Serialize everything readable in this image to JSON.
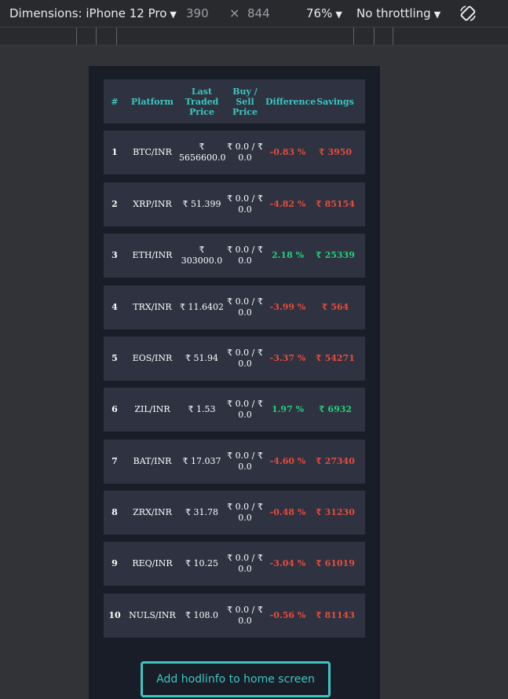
{
  "devtools": {
    "device_label": "Dimensions: iPhone 12 Pro",
    "width_value": "390",
    "times_symbol": "×",
    "height_value": "844",
    "zoom": "76%",
    "throttle": "No throttling",
    "caret": "▼"
  },
  "table": {
    "headers": [
      "#",
      "Platform",
      "Last Traded Price",
      "Buy / Sell Price",
      "Difference",
      "Savings"
    ],
    "rows": [
      {
        "num": "1",
        "platform": "BTC/INR",
        "ltp": "₹ 5656600.0",
        "bsp": "₹ 0.0 / ₹ 0.0",
        "diff": "-0.83 %",
        "savings": "₹ 3950",
        "trend": "neg"
      },
      {
        "num": "2",
        "platform": "XRP/INR",
        "ltp": "₹ 51.399",
        "bsp": "₹ 0.0 / ₹ 0.0",
        "diff": "-4.82 %",
        "savings": "₹ 85154",
        "trend": "neg"
      },
      {
        "num": "3",
        "platform": "ETH/INR",
        "ltp": "₹ 303000.0",
        "bsp": "₹ 0.0 / ₹ 0.0",
        "diff": "2.18 %",
        "savings": "₹ 25339",
        "trend": "pos"
      },
      {
        "num": "4",
        "platform": "TRX/INR",
        "ltp": "₹ 11.6402",
        "bsp": "₹ 0.0 / ₹ 0.0",
        "diff": "-3.99 %",
        "savings": "₹ 564",
        "trend": "neg"
      },
      {
        "num": "5",
        "platform": "EOS/INR",
        "ltp": "₹ 51.94",
        "bsp": "₹ 0.0 / ₹ 0.0",
        "diff": "-3.37 %",
        "savings": "₹ 54271",
        "trend": "neg"
      },
      {
        "num": "6",
        "platform": "ZIL/INR",
        "ltp": "₹ 1.53",
        "bsp": "₹ 0.0 / ₹ 0.0",
        "diff": "1.97 %",
        "savings": "₹ 6932",
        "trend": "pos"
      },
      {
        "num": "7",
        "platform": "BAT/INR",
        "ltp": "₹ 17.037",
        "bsp": "₹ 0.0 / ₹ 0.0",
        "diff": "-4.60 %",
        "savings": "₹ 27340",
        "trend": "neg"
      },
      {
        "num": "8",
        "platform": "ZRX/INR",
        "ltp": "₹ 31.78",
        "bsp": "₹ 0.0 / ₹ 0.0",
        "diff": "-0.48 %",
        "savings": "₹ 31230",
        "trend": "neg"
      },
      {
        "num": "9",
        "platform": "REQ/INR",
        "ltp": "₹ 10.25",
        "bsp": "₹ 0.0 / ₹ 0.0",
        "diff": "-3.04 %",
        "savings": "₹ 61019",
        "trend": "neg"
      },
      {
        "num": "10",
        "platform": "NULS/INR",
        "ltp": "₹ 108.0",
        "bsp": "₹ 0.0 / ₹ 0.0",
        "diff": "-0.56 %",
        "savings": "₹ 81143",
        "trend": "neg"
      }
    ]
  },
  "add_button_label": "Add hodlinfo to home screen",
  "colors": {
    "accent": "#3dc6c1",
    "negative": "#e74c3c",
    "positive": "#23d17a",
    "page_bg": "#191d28",
    "row_bg": "#2e3241"
  },
  "icons": {
    "rotate": "rotate-device-icon",
    "dropdown": "dropdown-caret-icon"
  }
}
